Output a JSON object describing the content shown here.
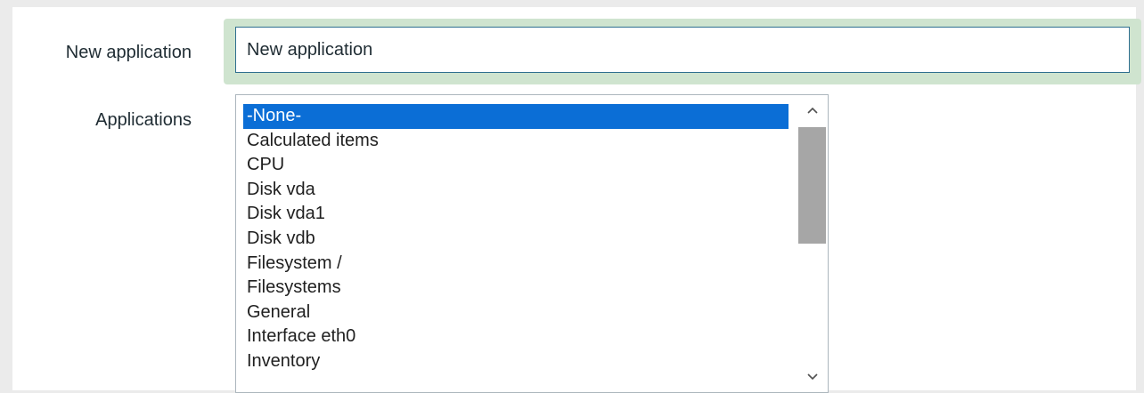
{
  "form": {
    "new_application": {
      "label": "New application",
      "value": "New application"
    },
    "applications": {
      "label": "Applications",
      "selected": "-None-",
      "scroll_position": 0,
      "options": [
        "-None-",
        "Calculated items",
        "CPU",
        "Disk vda",
        "Disk vda1",
        "Disk vdb",
        "Filesystem /",
        "Filesystems",
        "General",
        "Interface eth0",
        "Inventory"
      ]
    }
  },
  "icons": {
    "scroll_up": "chevron-up-icon",
    "scroll_down": "chevron-down-icon"
  },
  "colors": {
    "selection": "#0b6ed6",
    "focus_ring": "#cfe4cf",
    "input_border": "#2f6f8f",
    "scroll_thumb": "#a6a6a6"
  }
}
